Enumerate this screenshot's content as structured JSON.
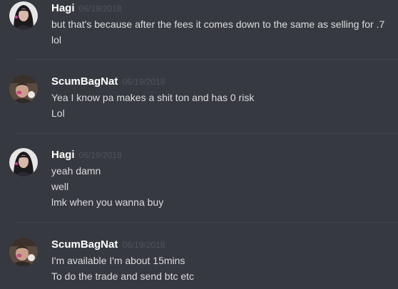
{
  "messages": [
    {
      "author": "Hagi",
      "timestamp": "06/19/2018",
      "avatar_icon": "user-avatar-hagi",
      "lines": [
        "but that's because after the fees it comes down to the same as selling for .7",
        "lol"
      ]
    },
    {
      "author": "ScumBagNat",
      "timestamp": "06/19/2018",
      "avatar_icon": "user-avatar-scumbagnat",
      "lines": [
        "Yea I know pa makes a shit ton and has 0 risk",
        "Lol"
      ]
    },
    {
      "author": "Hagi",
      "timestamp": "06/19/2018",
      "avatar_icon": "user-avatar-hagi",
      "lines": [
        "yeah damn",
        "well",
        "lmk when you wanna buy"
      ]
    },
    {
      "author": "ScumBagNat",
      "timestamp": "06/19/2018",
      "avatar_icon": "user-avatar-scumbagnat",
      "lines": [
        "I'm available I'm about 15mins",
        "To do the trade and send btc etc"
      ]
    }
  ],
  "colors": {
    "background": "#36393f",
    "username": "#ffffff",
    "timestamp": "#4f545c",
    "message_text": "#dcddde",
    "divider": "#42464d"
  }
}
